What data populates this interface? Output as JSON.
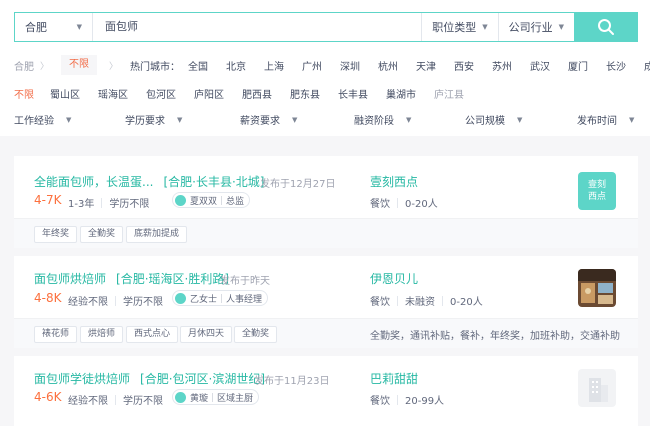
{
  "search": {
    "city": "合肥",
    "query": "面包师",
    "job_type": "职位类型",
    "industry": "公司行业"
  },
  "city_filter": {
    "current": "合肥",
    "unlimited": "不限",
    "hot_label": "热门城市：",
    "hot_cities": [
      "全国",
      "北京",
      "上海",
      "广州",
      "深圳",
      "杭州",
      "天津",
      "西安",
      "苏州",
      "武汉",
      "厦门",
      "长沙",
      "成都"
    ]
  },
  "district_filter": {
    "unlimited": "不限",
    "districts": [
      "蜀山区",
      "瑶海区",
      "包河区",
      "庐阳区",
      "肥西县",
      "肥东县",
      "长丰县",
      "巢湖市"
    ],
    "faded_district": "庐江县"
  },
  "filters": [
    {
      "label": "工作经验"
    },
    {
      "label": "学历要求"
    },
    {
      "label": "薪资要求"
    },
    {
      "label": "融资阶段"
    },
    {
      "label": "公司规模"
    },
    {
      "label": "发布时间"
    }
  ],
  "jobs": [
    {
      "title": "全能面包师，长温蛋...",
      "location": "[合肥·长丰县·北城]",
      "published": "发布于12月27日",
      "salary": "4-7K",
      "experience": "1-3年",
      "education": "学历不限",
      "recruiter": "夏双双",
      "recruiter_role": "总监",
      "company": "壹刻西点",
      "industry": "餐饮",
      "size": "0-20人",
      "logo_text_1": "壹刻",
      "logo_text_2": "西点",
      "tags": [
        "年终奖",
        "全勤奖",
        "底薪加提成"
      ],
      "benefits": ""
    },
    {
      "title": "面包师烘焙师",
      "location": "[合肥·瑶海区·胜利路]",
      "published": "发布于昨天",
      "salary": "4-8K",
      "experience": "经验不限",
      "education": "学历不限",
      "recruiter": "乙女士",
      "recruiter_role": "人事经理",
      "company": "伊恩贝儿",
      "industry": "餐饮",
      "financing": "未融资",
      "size": "0-20人",
      "tags": [
        "裱花师",
        "烘焙师",
        "西式点心",
        "月休四天",
        "全勤奖"
      ],
      "benefits": "全勤奖，通讯补贴，餐补，年终奖，加班补助，交通补助"
    },
    {
      "title": "面包师学徒烘焙师",
      "location": "[合肥·包河区·滨湖世纪]",
      "published": "发布于11月23日",
      "salary": "4-6K",
      "experience": "经验不限",
      "education": "学历不限",
      "recruiter": "黄璇",
      "recruiter_role": "区域主厨",
      "company": "巴莉甜甜",
      "industry": "餐饮",
      "size": "20-99人"
    }
  ],
  "colors": {
    "accent": "#5dd5c8",
    "title_teal": "#26b8a3",
    "salary_orange": "#fc703e",
    "active_filter": "#f26d49"
  }
}
